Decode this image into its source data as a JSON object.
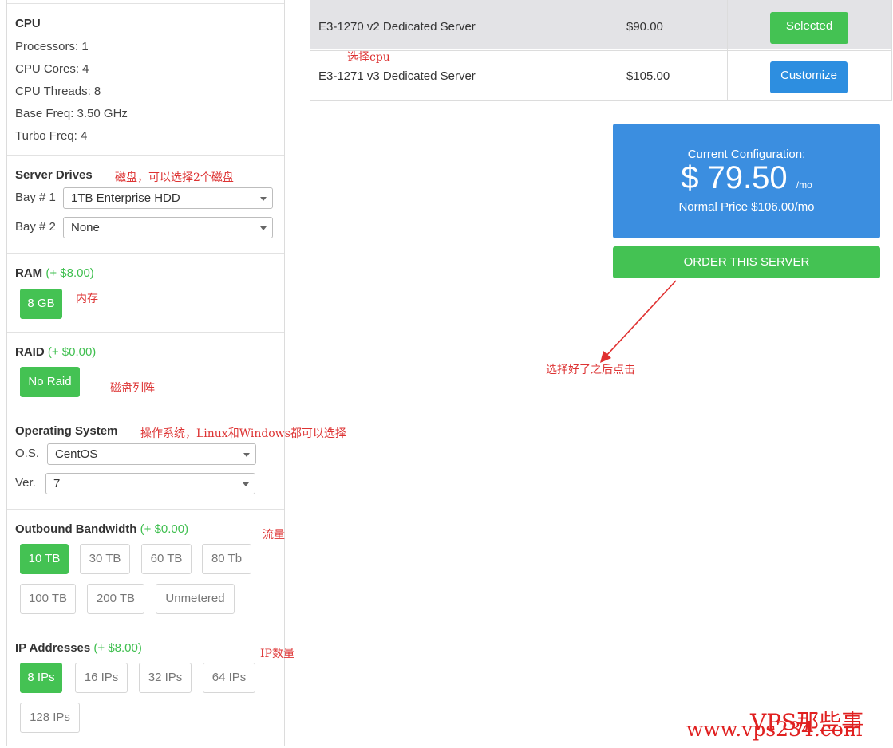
{
  "servers": [
    {
      "name": "E3-1270 v2 Dedicated Server",
      "price": "$90.00",
      "action": "Selected"
    },
    {
      "name": "E3-1271 v3 Dedicated Server",
      "price": "$105.00",
      "action": "Customize"
    }
  ],
  "cpu": {
    "title": "CPU",
    "specs": [
      "Processors: 1",
      "CPU Cores: 4",
      "CPU Threads: 8",
      "Base Freq: 3.50 GHz",
      "Turbo Freq: 4"
    ]
  },
  "drives": {
    "title": "Server Drives",
    "bay1_label": "Bay # 1",
    "bay1_value": "1TB Enterprise HDD",
    "bay2_label": "Bay # 2",
    "bay2_value": "None"
  },
  "ram": {
    "title": "RAM",
    "price": "(+ $8.00)",
    "options": [
      "8 GB"
    ]
  },
  "raid": {
    "title": "RAID",
    "price": "(+ $0.00)",
    "options": [
      "No Raid"
    ]
  },
  "os": {
    "title": "Operating System",
    "os_label": "O.S.",
    "os_value": "CentOS",
    "ver_label": "Ver.",
    "ver_value": "7"
  },
  "bandwidth": {
    "title": "Outbound Bandwidth",
    "price": "(+ $0.00)",
    "options": [
      "10 TB",
      "30 TB",
      "60 TB",
      "80 Tb",
      "100 TB",
      "200 TB",
      "Unmetered"
    ]
  },
  "ips": {
    "title": "IP Addresses",
    "price": "(+ $8.00)",
    "options": [
      "8 IPs",
      "16 IPs",
      "32 IPs",
      "64 IPs",
      "128 IPs"
    ]
  },
  "config": {
    "title": "Current Configuration:",
    "price": "$ 79.50",
    "unit": "/mo",
    "normal": "Normal Price $106.00/mo"
  },
  "order_label": "ORDER THIS SERVER",
  "notes": {
    "cpu": "选择cpu",
    "drives": "磁盘，可以选择2个磁盘",
    "ram": "内存",
    "raid": "磁盘列阵",
    "os": "操作系统，Linux和Windows都可以选择",
    "bandwidth": "流量",
    "ips": "IP数量",
    "order": "选择好了之后点击"
  },
  "watermark": {
    "line1": "VPS那些事",
    "line2": "www.vps234.com"
  },
  "colors": {
    "green": "#44c253",
    "blue": "#3b8ee0",
    "annotation": "#dd3333"
  }
}
